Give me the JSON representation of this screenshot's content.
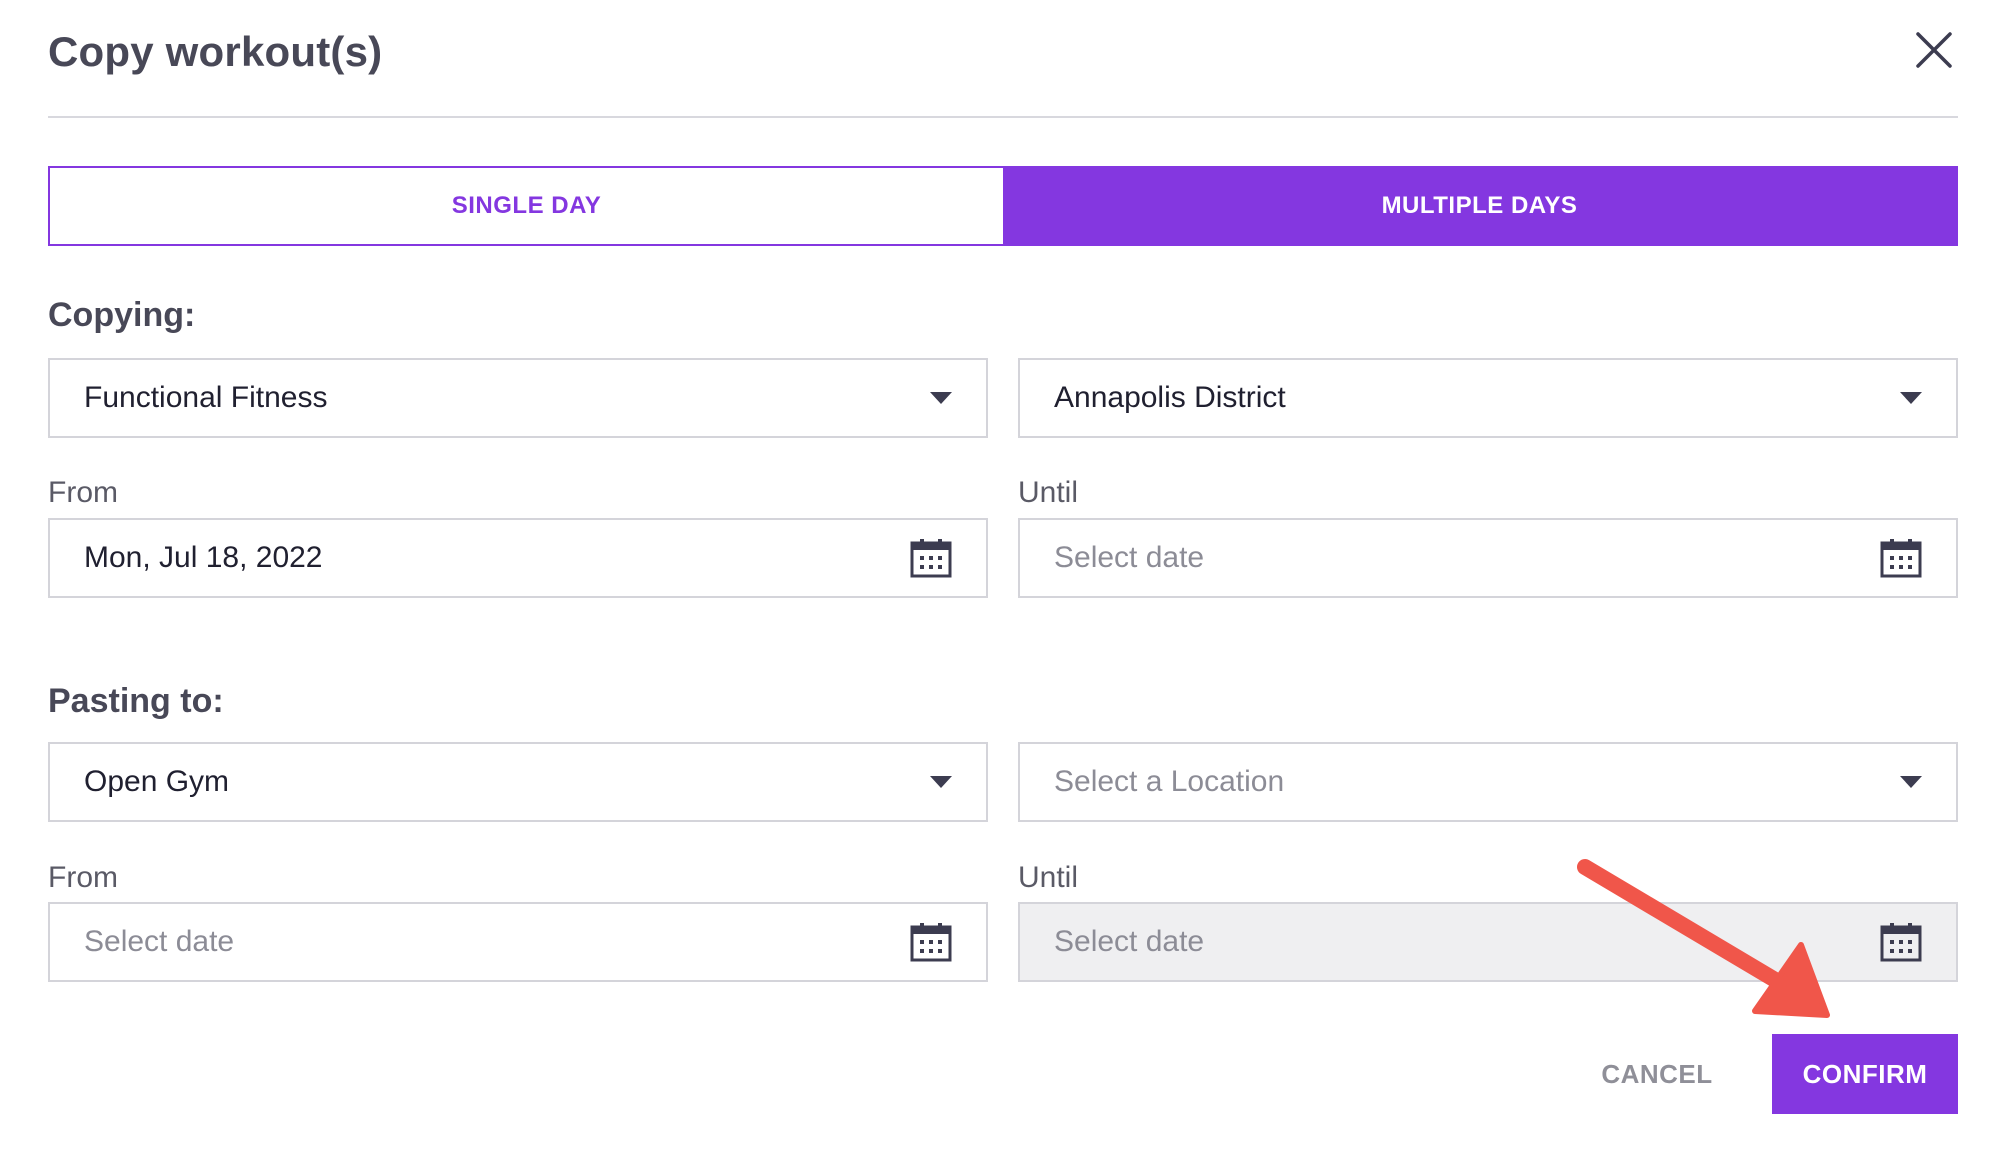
{
  "dialog": {
    "title": "Copy workout(s)",
    "close_icon": "close-icon"
  },
  "mode_toggle": {
    "single_day_label": "SINGLE DAY",
    "multiple_days_label": "MULTIPLE DAYS",
    "selected": "MULTIPLE DAYS"
  },
  "copying": {
    "heading": "Copying:",
    "program": {
      "value": "Functional Fitness"
    },
    "location": {
      "value": "Annapolis District"
    },
    "from": {
      "label": "From",
      "value": "Mon, Jul 18, 2022"
    },
    "until": {
      "label": "Until",
      "placeholder": "Select date"
    }
  },
  "pasting": {
    "heading": "Pasting to:",
    "program": {
      "value": "Open Gym"
    },
    "location": {
      "placeholder": "Select a Location"
    },
    "from": {
      "label": "From",
      "placeholder": "Select date"
    },
    "until": {
      "label": "Until",
      "placeholder": "Select date"
    }
  },
  "actions": {
    "cancel_label": "CANCEL",
    "confirm_label": "CONFIRM"
  },
  "colors": {
    "accent": "#8437e0",
    "annotation_arrow": "#f0564a"
  }
}
